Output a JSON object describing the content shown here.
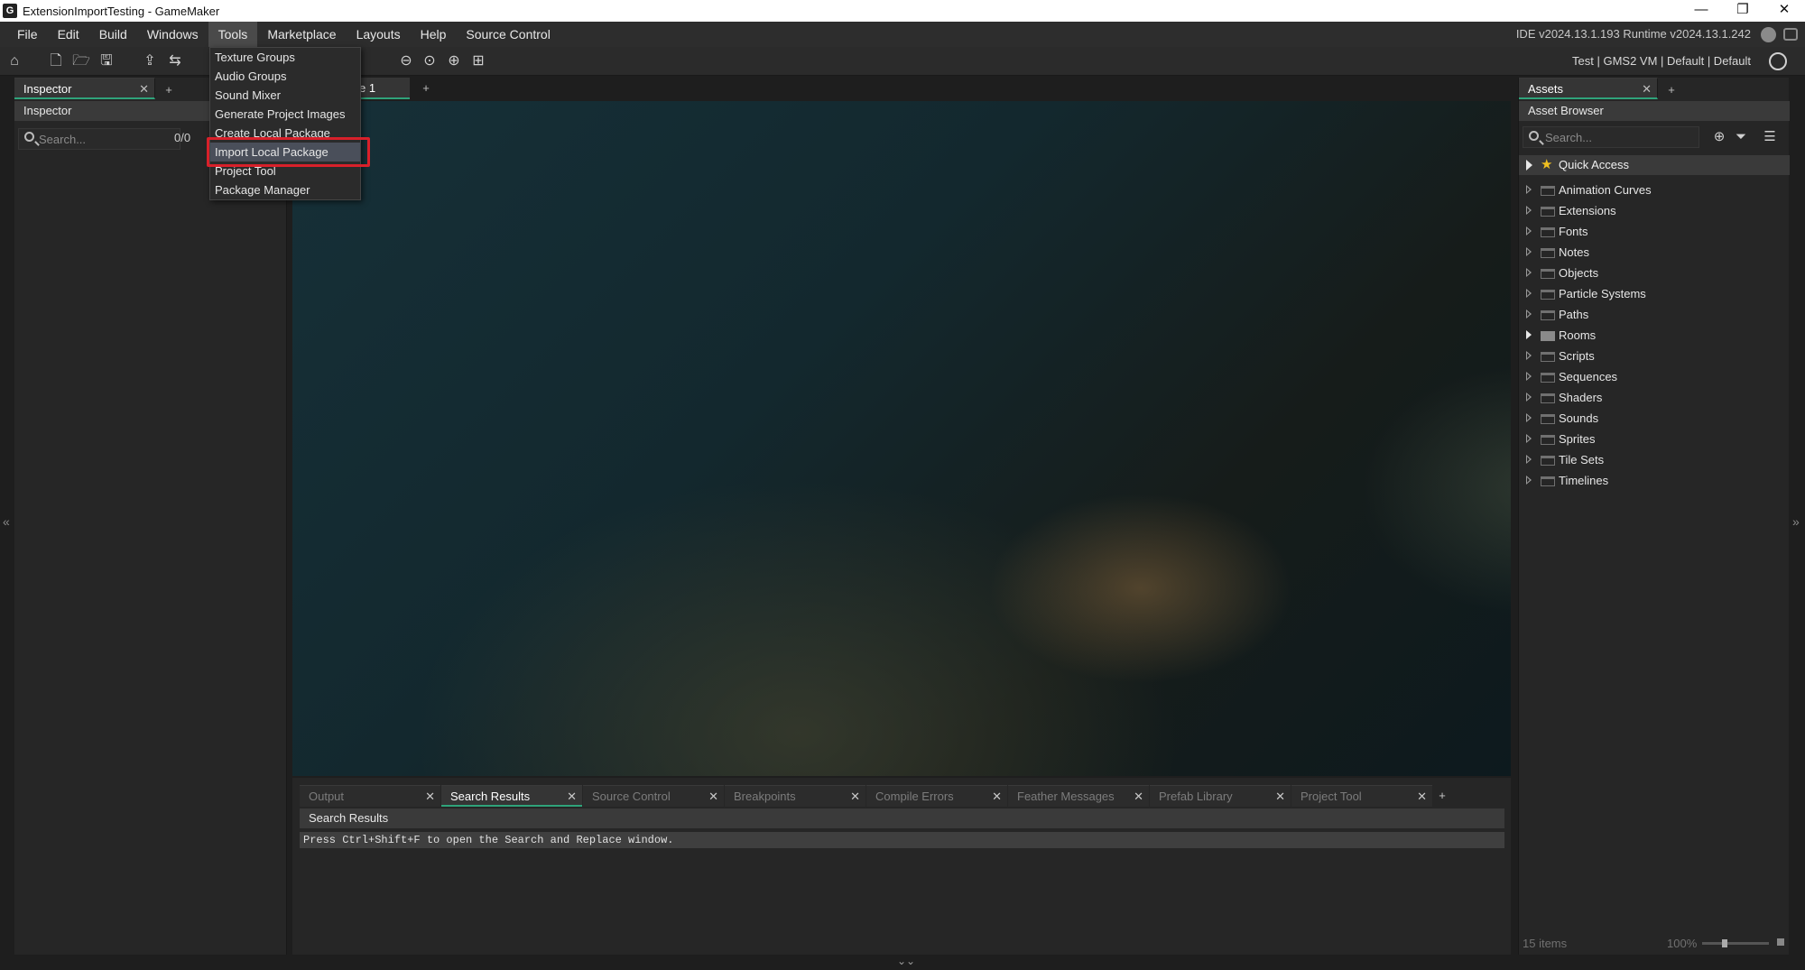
{
  "window": {
    "title": "ExtensionImportTesting - GameMaker",
    "controls": [
      "—",
      "❐",
      "✕"
    ]
  },
  "menubar": {
    "items": [
      "File",
      "Edit",
      "Build",
      "Windows",
      "Tools",
      "Marketplace",
      "Layouts",
      "Help",
      "Source Control"
    ],
    "active": "Tools",
    "versions": "IDE v2024.13.1.193  Runtime v2024.13.1.242"
  },
  "toolbar": {
    "target": "Test  |  GMS2 VM  |  Default  |  Default"
  },
  "tools_menu": {
    "items": [
      "Texture Groups",
      "Audio Groups",
      "Sound Mixer",
      "Generate Project Images",
      "Create Local Package",
      "Import Local Package",
      "Project Tool",
      "Package Manager"
    ],
    "highlighted": "Import Local Package"
  },
  "inspector": {
    "tab_label": "Inspector",
    "header": "Inspector",
    "search_placeholder": "Search...",
    "count": "0/0"
  },
  "room_editor": {
    "tab_label": "e 1"
  },
  "output": {
    "tabs": [
      "Output",
      "Search Results",
      "Source Control",
      "Breakpoints",
      "Compile Errors",
      "Feather Messages",
      "Prefab Library",
      "Project Tool"
    ],
    "active_tab": "Search Results",
    "header": "Search Results",
    "message": "Press Ctrl+Shift+F to open the Search and Replace window."
  },
  "assets": {
    "tab_label": "Assets",
    "header": "Asset Browser",
    "search_placeholder": "Search...",
    "quick_access": "Quick Access",
    "folders": [
      "Animation Curves",
      "Extensions",
      "Fonts",
      "Notes",
      "Objects",
      "Particle Systems",
      "Paths",
      "Rooms",
      "Scripts",
      "Sequences",
      "Shaders",
      "Sounds",
      "Sprites",
      "Tile Sets",
      "Timelines"
    ],
    "footer_items": "15 items",
    "zoom": "100%"
  },
  "colors": {
    "accent_tab": "#2fa37a",
    "annotation": "#d8202a",
    "star": "#f0c020"
  }
}
